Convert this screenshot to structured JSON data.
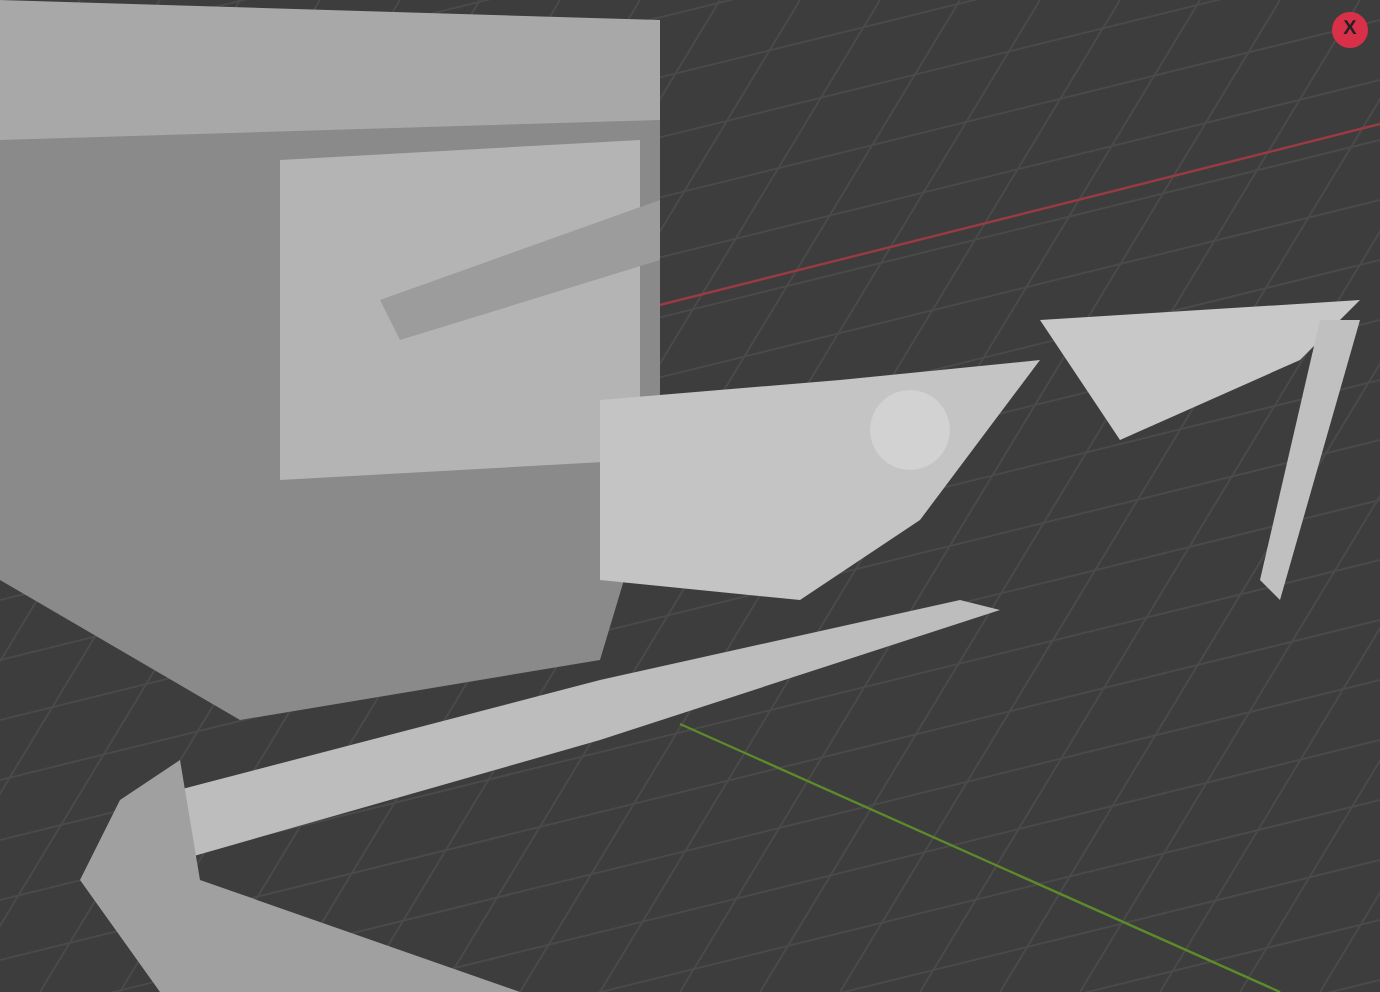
{
  "viewport": {
    "gizmo_axes": [
      {
        "label": "X",
        "color": "#d9304a"
      }
    ]
  }
}
